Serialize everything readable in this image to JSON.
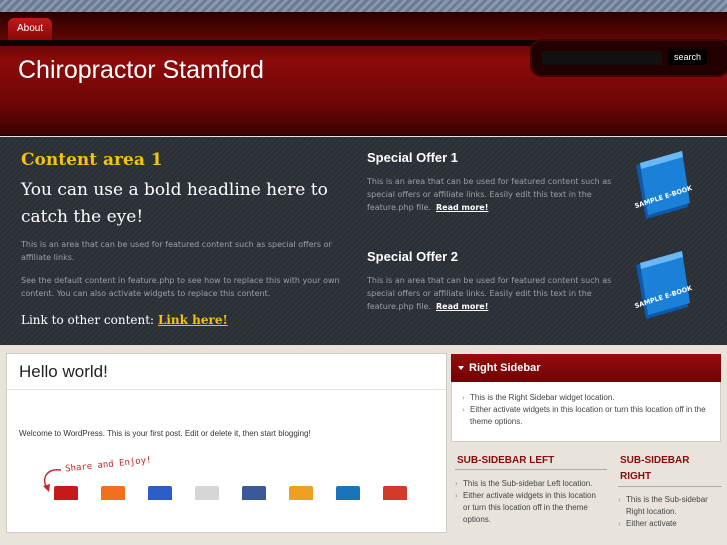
{
  "nav": {
    "about": "About"
  },
  "header": {
    "site_title": "Chiropractor Stamford",
    "search_button": "search"
  },
  "feature": {
    "content_area": {
      "title": "Content area 1",
      "headline": "You can use a bold headline here to catch the eye!",
      "paragraph1": "This is an area that can be used for featured content such as special offers or affiliate links.",
      "paragraph2": "See the default content in feature.php to see how to replace this with your own content. You can also activate widgets to replace this content.",
      "link_prefix": "Link to other content:",
      "link_text": "Link here!"
    },
    "offers": [
      {
        "title": "Special Offer 1",
        "text": "This is an area that can be used for featured content such as special offers or affiliate links. Easily edit this text in the feature.php file.",
        "read_more": "Read more!",
        "book_label": "SAMPLE E-BOOK"
      },
      {
        "title": "Special Offer 2",
        "text": "This is an area that can be used for featured content such as special offers or affiliate links. Easily edit this text in the feature.php file.",
        "read_more": "Read more!",
        "book_label": "SAMPLE E-BOOK"
      }
    ]
  },
  "post": {
    "title": "Hello world!",
    "body": "Welcome to WordPress. This is your first post. Edit or delete it, then start blogging!",
    "share_label": "Share and Enjoy!",
    "share_icons": [
      {
        "icon": "youtube-icon",
        "color": "#c61a1a"
      },
      {
        "icon": "blogger-icon",
        "color": "#f26f1d"
      },
      {
        "icon": "delicious-icon",
        "color": "#2b5cc8"
      },
      {
        "icon": "digg-icon",
        "color": "#d6d6d6"
      },
      {
        "icon": "facebook-icon",
        "color": "#3b5998"
      },
      {
        "icon": "mixx-icon",
        "color": "#f0a020"
      },
      {
        "icon": "linkedin-icon",
        "color": "#1a75b8"
      },
      {
        "icon": "google-plus-icon",
        "color": "#d43a2a"
      }
    ]
  },
  "right_sidebar": {
    "title": "Right Sidebar",
    "items": [
      "This is the Right Sidebar widget location.",
      "Either activate widgets in this location or turn this location off in the theme options."
    ]
  },
  "sub_sidebar_left": {
    "title": "SUB-SIDEBAR LEFT",
    "items": [
      "This is the Sub-sidebar Left location.",
      "Either activate widgets in this location or turn this location off in the theme options."
    ]
  },
  "sub_sidebar_right": {
    "title": "SUB-SIDEBAR RIGHT",
    "items": [
      "This is the Sub-sidebar Right location.",
      "Either activate"
    ]
  },
  "colors": {
    "brand_red": "#8c0a0a",
    "accent_yellow": "#f2c40a",
    "feature_bg": "#2b2f36",
    "book_blue": "#1a80d8"
  }
}
